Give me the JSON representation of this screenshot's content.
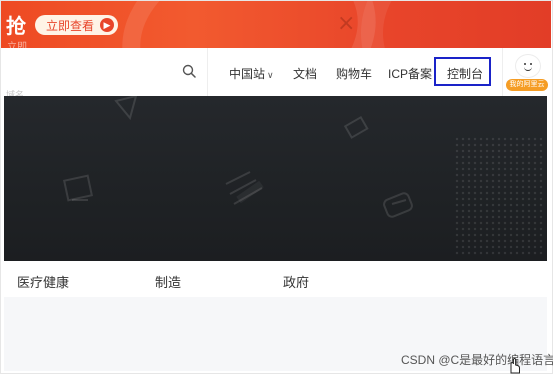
{
  "promo": {
    "headline": "抢",
    "cta_label": "立即查看",
    "close_symbol": "×",
    "ghost_caption": "立即"
  },
  "nav": {
    "items": [
      {
        "label": "中国站",
        "has_dropdown": true
      },
      {
        "label": "文档"
      },
      {
        "label": "购物车"
      },
      {
        "label": "ICP备案"
      },
      {
        "label": "控制台"
      }
    ],
    "avatar_badge": "我的阿里云",
    "ghost_hint": "域名"
  },
  "industries": {
    "tabs": [
      {
        "label": "医疗健康"
      },
      {
        "label": "制造"
      },
      {
        "label": "政府"
      }
    ]
  },
  "watermark": "CSDN @C是最好的编程语言",
  "colors": {
    "promo_bg": "#ee4a23",
    "highlight_box": "#1a23c8",
    "badge": "#f59d25",
    "hero_bg": "#222529"
  },
  "icons": [
    "search-icon",
    "close-icon",
    "chevron-down-icon",
    "arrow-right-icon",
    "avatar-icon",
    "hand-cursor-icon"
  ]
}
